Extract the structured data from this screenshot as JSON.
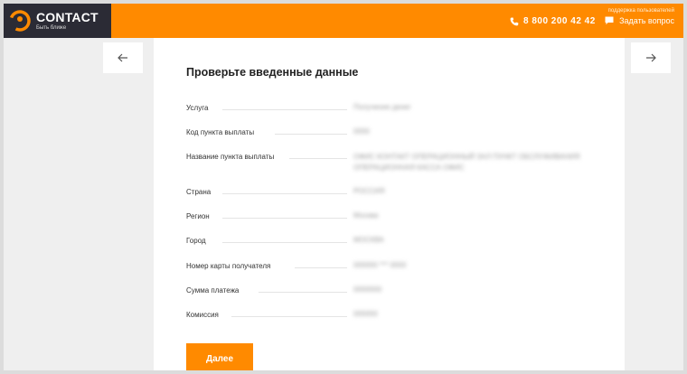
{
  "header": {
    "brand_name": "CONTACT",
    "brand_tagline": "Быть ближе",
    "phone": "8 800 200 42 42",
    "support_label": "поддержка пользователей",
    "ask_question": "Задать вопрос",
    "colors": {
      "accent": "#ff8a00",
      "logo_bg": "#2b2b35"
    },
    "icons": {
      "phone": "phone-icon",
      "chat": "chat-icon"
    }
  },
  "nav": {
    "prev": "←",
    "next": "→"
  },
  "card": {
    "title": "Проверьте введенные данные",
    "rows": [
      {
        "label": "Услуга",
        "value": "Получение денег"
      },
      {
        "label": "Код пункта выплаты",
        "value": "0000"
      },
      {
        "label": "Название пункта выплаты",
        "value": "ОФИС КОНТАКТ ОПЕРАЦИОННЫЙ ЗАЛ ПУНКТ ОБСЛУЖИВАНИЯ",
        "value2": "ОПЕРАЦИОННАЯ КАССА ОФИС"
      },
      {
        "label": "Страна",
        "value": "РОССИЯ"
      },
      {
        "label": "Регион",
        "value": "Москва"
      },
      {
        "label": "Город",
        "value": "МОСКВА"
      },
      {
        "label": "Номер карты получателя",
        "value": "000000 *** 0000"
      },
      {
        "label": "Сумма платежа",
        "value": "0000000"
      },
      {
        "label": "Комиссия",
        "value": "000000"
      }
    ],
    "submit": "Далее"
  }
}
